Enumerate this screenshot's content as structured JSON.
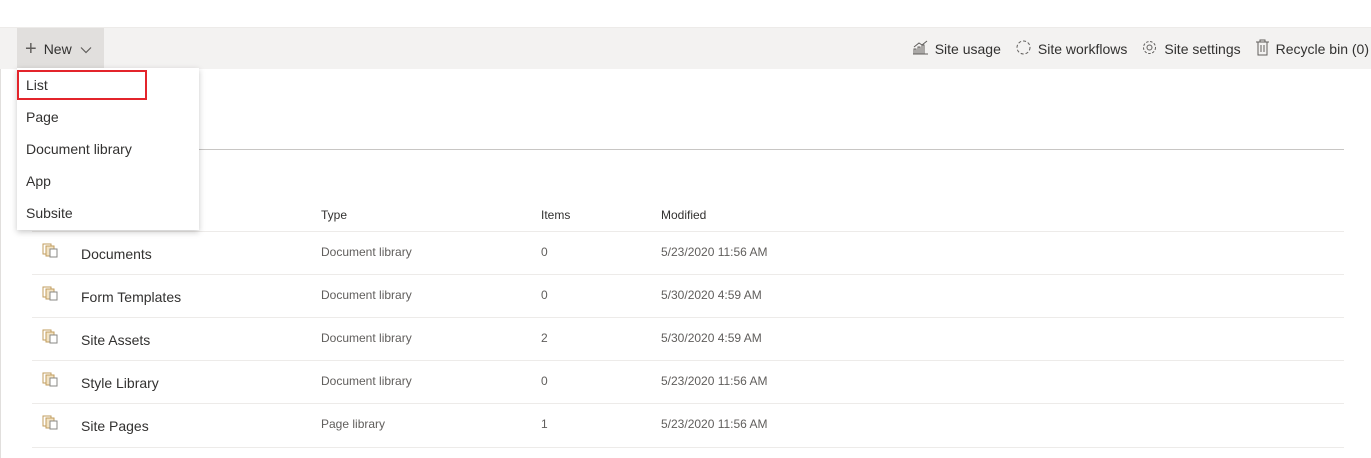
{
  "toolbar": {
    "new_label": "New",
    "site_usage": "Site usage",
    "site_workflows": "Site workflows",
    "site_settings": "Site settings",
    "recycle_bin": "Recycle bin (0)"
  },
  "new_menu": {
    "items": [
      "List",
      "Page",
      "Document library",
      "App",
      "Subsite"
    ],
    "highlighted": "List",
    "highlight_color": "#e3242b"
  },
  "table": {
    "headers": {
      "type": "Type",
      "items": "Items",
      "modified": "Modified"
    },
    "rows": [
      {
        "name": "Documents",
        "type": "Document library",
        "items": "0",
        "modified": "5/23/2020 11:56 AM"
      },
      {
        "name": "Form Templates",
        "type": "Document library",
        "items": "0",
        "modified": "5/30/2020 4:59 AM"
      },
      {
        "name": "Site Assets",
        "type": "Document library",
        "items": "2",
        "modified": "5/30/2020 4:59 AM"
      },
      {
        "name": "Style Library",
        "type": "Document library",
        "items": "0",
        "modified": "5/23/2020 11:56 AM"
      },
      {
        "name": "Site Pages",
        "type": "Page library",
        "items": "1",
        "modified": "5/23/2020 11:56 AM"
      }
    ]
  },
  "icons": {
    "new": "plus-icon",
    "dropdown": "chevron-down-icon",
    "site_usage": "chart-icon",
    "site_workflows": "workflow-icon",
    "site_settings": "gear-icon",
    "recycle_bin": "trash-icon",
    "library": "library-icon"
  }
}
